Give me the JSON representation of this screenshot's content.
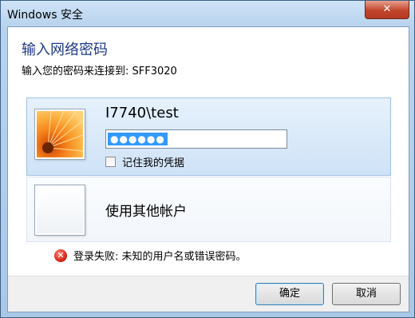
{
  "window": {
    "title": "Windows 安全",
    "close_glyph": "✕"
  },
  "main": {
    "heading": "输入网络密码",
    "subheading": "输入您的密码来连接到: SFF3020"
  },
  "credentials": {
    "selected": {
      "username": "I7740\\test",
      "password_mask": "●●●●●●",
      "remember_label": "记住我的凭据",
      "remember_checked": false
    },
    "other": {
      "label": "使用其他帐户"
    }
  },
  "error": {
    "icon": "error-x-icon",
    "message": "登录失败: 未知的用户名或错误密码。"
  },
  "buttons": {
    "ok": "确定",
    "cancel": "取消"
  },
  "colors": {
    "heading": "#1e3a87",
    "selection": "#3399ff",
    "close": "#c2452c"
  }
}
